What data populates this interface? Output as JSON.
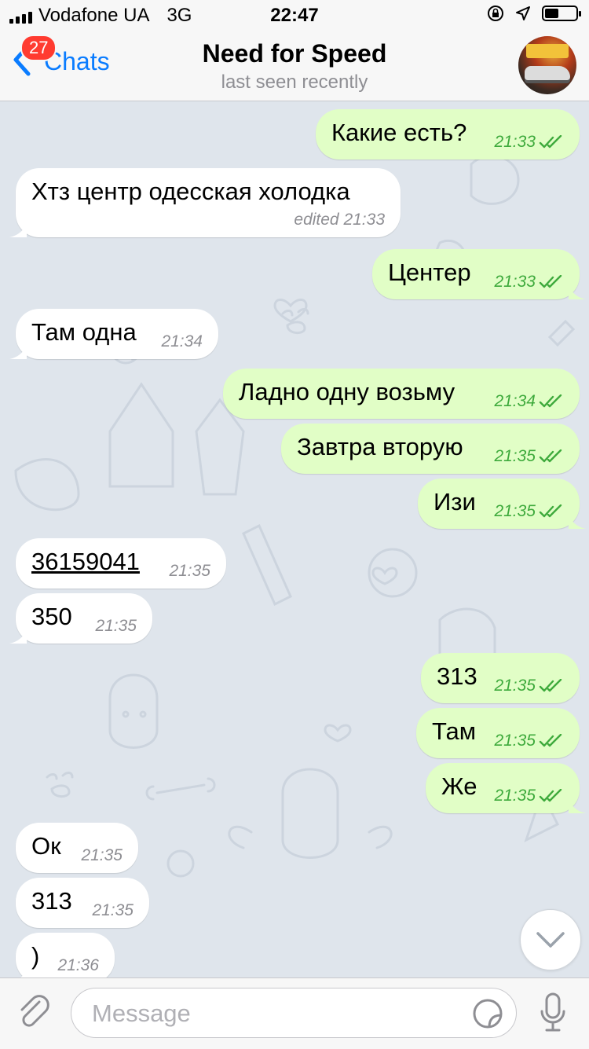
{
  "status_bar": {
    "carrier": "Vodafone UA",
    "network": "3G",
    "time": "22:47",
    "battery_level": 0.45,
    "icons": [
      "signal-icon",
      "lock-rotation-icon",
      "location-icon",
      "battery-icon"
    ]
  },
  "header": {
    "back_label": "Chats",
    "unread_count": "27",
    "title": "Need for Speed",
    "subtitle": "last seen recently",
    "avatar": "chat-avatar"
  },
  "messages": [
    {
      "dir": "out",
      "text": "Какие есть?",
      "time": "21:33",
      "read": true
    },
    {
      "dir": "in",
      "text": "Хтз центр одесская холодка",
      "time": "edited 21:33"
    },
    {
      "dir": "out",
      "text": "Центер",
      "time": "21:33",
      "read": true
    },
    {
      "dir": "in",
      "text": "Там одна",
      "time": "21:34"
    },
    {
      "dir": "out",
      "text": "Ладно одну возьму",
      "time": "21:34",
      "read": true
    },
    {
      "dir": "out",
      "text": "Завтра вторую",
      "time": "21:35",
      "read": true
    },
    {
      "dir": "out",
      "text": "Изи",
      "time": "21:35",
      "read": true
    },
    {
      "dir": "in",
      "text": "36159041",
      "time": "21:35",
      "link": true
    },
    {
      "dir": "in",
      "text": "350",
      "time": "21:35"
    },
    {
      "dir": "out",
      "text": "313",
      "time": "21:35",
      "read": true
    },
    {
      "dir": "out",
      "text": "Там",
      "time": "21:35",
      "read": true
    },
    {
      "dir": "out",
      "text": "Же",
      "time": "21:35",
      "read": true
    },
    {
      "dir": "in",
      "text": "Ок",
      "time": "21:35"
    },
    {
      "dir": "in",
      "text": "313",
      "time": "21:35"
    },
    {
      "dir": "in",
      "text": ")",
      "time": "21:36"
    }
  ],
  "input": {
    "placeholder": "Message",
    "value": ""
  },
  "colors": {
    "accent": "#0a7cff",
    "outgoing_bubble": "#e1fec6",
    "incoming_bubble": "#ffffff",
    "read_check": "#3eaa3c",
    "badge": "#ff3b30",
    "chat_background": "#dfe5ec"
  }
}
